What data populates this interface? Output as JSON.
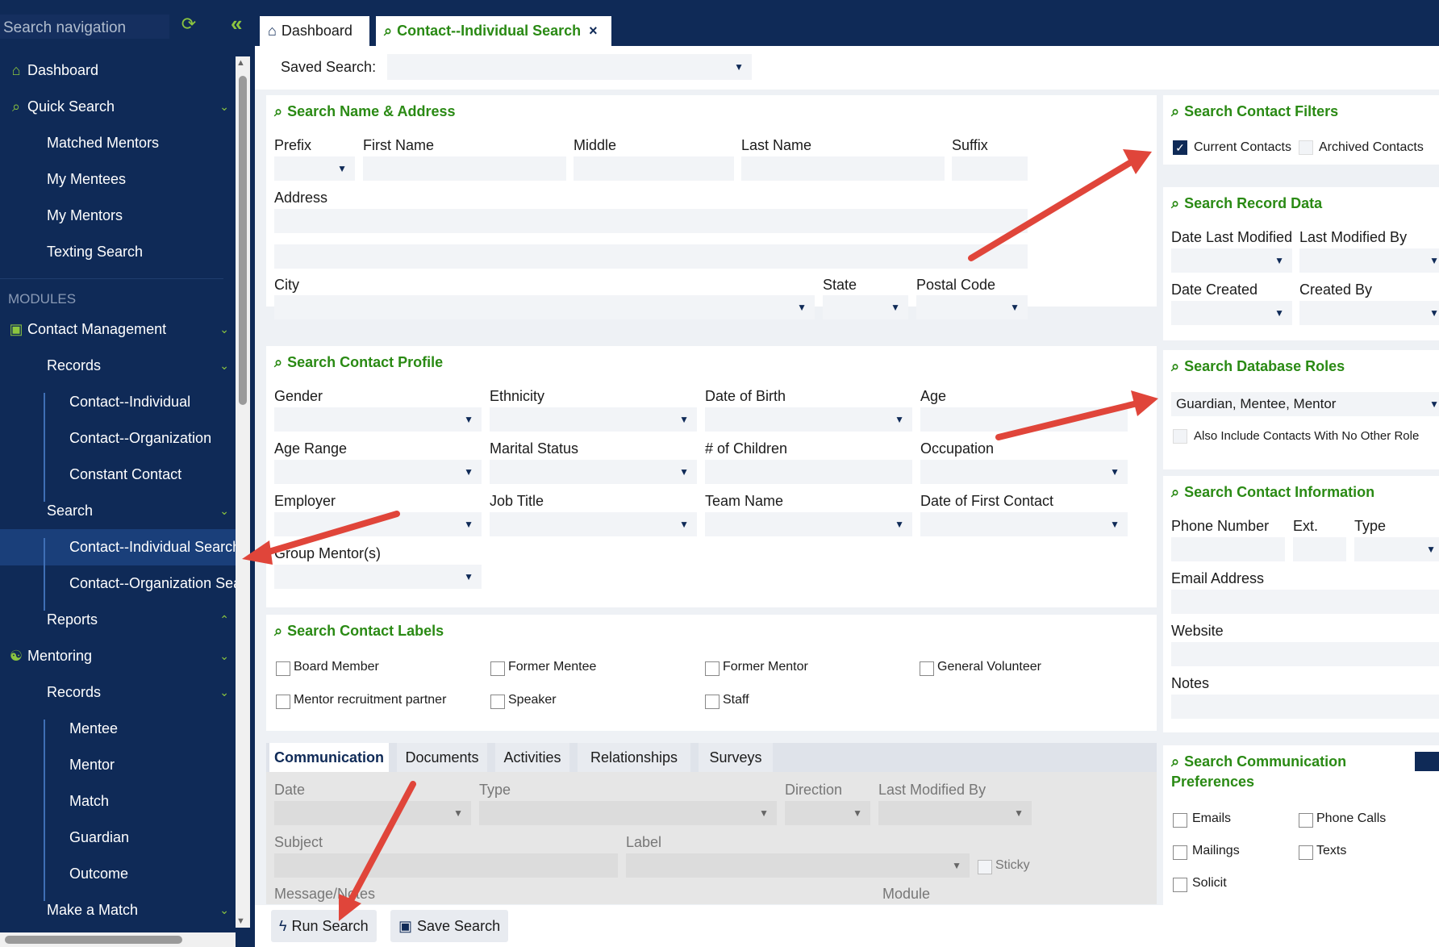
{
  "sidebar": {
    "search_placeholder": "Search navigation",
    "items": [
      {
        "label": "Dashboard"
      },
      {
        "label": "Quick Search"
      },
      {
        "label": "Matched Mentors"
      },
      {
        "label": "My Mentees"
      },
      {
        "label": "My Mentors"
      },
      {
        "label": "Texting Search"
      }
    ],
    "modules_label": "MODULES",
    "modules": [
      {
        "label": "Contact Management"
      },
      {
        "label": "Records"
      },
      {
        "label": "Contact--Individual"
      },
      {
        "label": "Contact--Organization"
      },
      {
        "label": "Constant Contact"
      },
      {
        "label": "Search"
      },
      {
        "label": "Contact--Individual Search"
      },
      {
        "label": "Contact--Organization Search"
      },
      {
        "label": "Reports"
      },
      {
        "label": "Mentoring"
      },
      {
        "label": "Records"
      },
      {
        "label": "Mentee"
      },
      {
        "label": "Mentor"
      },
      {
        "label": "Match"
      },
      {
        "label": "Guardian"
      },
      {
        "label": "Outcome"
      },
      {
        "label": "Make a Match"
      }
    ]
  },
  "tabs": [
    {
      "label": "Dashboard"
    },
    {
      "label": "Contact--Individual Search"
    }
  ],
  "saved_search": {
    "label": "Saved Search:",
    "value": ""
  },
  "name_address": {
    "title": "Search Name & Address",
    "labels": {
      "prefix": "Prefix",
      "first": "First Name",
      "middle": "Middle",
      "last": "Last Name",
      "suffix": "Suffix",
      "address": "Address",
      "city": "City",
      "state": "State",
      "postal": "Postal Code"
    }
  },
  "contact_filters": {
    "title": "Search Contact Filters",
    "current": "Current Contacts",
    "archived": "Archived Contacts"
  },
  "record_data": {
    "title": "Search Record Data",
    "labels": {
      "date_modified": "Date Last Modified",
      "modified_by": "Last Modified By",
      "date_created": "Date Created",
      "created_by": "Created By"
    }
  },
  "contact_profile": {
    "title": "Search Contact Profile",
    "labels": {
      "gender": "Gender",
      "ethnicity": "Ethnicity",
      "dob": "Date of Birth",
      "age": "Age",
      "age_range": "Age Range",
      "marital": "Marital Status",
      "children": "# of Children",
      "occupation": "Occupation",
      "employer": "Employer",
      "job_title": "Job Title",
      "team": "Team Name",
      "first_contact": "Date of First Contact",
      "group_mentors": "Group Mentor(s)"
    }
  },
  "database_roles": {
    "title": "Search Database Roles",
    "value": "Guardian, Mentee, Mentor",
    "include_label": "Also Include Contacts With No Other Role"
  },
  "contact_info": {
    "title": "Search Contact Information",
    "labels": {
      "phone": "Phone Number",
      "ext": "Ext.",
      "type": "Type",
      "email": "Email Address",
      "website": "Website",
      "notes": "Notes"
    }
  },
  "contact_labels": {
    "title": "Search Contact Labels",
    "items": [
      "Board Member",
      "Former Mentee",
      "Former Mentor",
      "General Volunteer",
      "Mentor recruitment partner",
      "Speaker",
      "Staff"
    ]
  },
  "comm_prefs": {
    "title_line1": "Search Communication",
    "title_line2": "Preferences",
    "items": [
      "Emails",
      "Phone Calls",
      "Mailings",
      "Texts",
      "Solicit"
    ]
  },
  "comm_tabs": [
    "Communication",
    "Documents",
    "Activities",
    "Relationships",
    "Surveys"
  ],
  "comm_fields": {
    "date": "Date",
    "type": "Type",
    "direction": "Direction",
    "modified_by": "Last Modified By",
    "subject": "Subject",
    "label": "Label",
    "sticky": "Sticky",
    "message": "Message/Notes",
    "module": "Module"
  },
  "buttons": {
    "run": "Run Search",
    "save": "Save Search"
  },
  "colors": {
    "navy": "#0f2a57",
    "green": "#2a8a14",
    "lime": "#8cc63f",
    "arrow": "#e0453a"
  }
}
